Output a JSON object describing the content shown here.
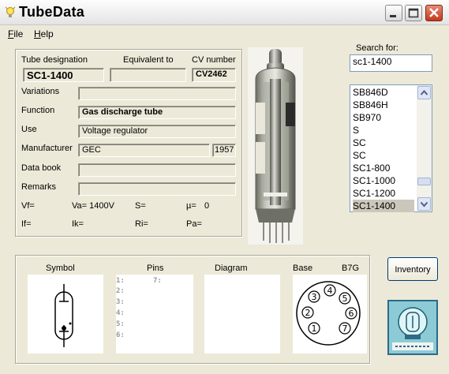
{
  "window": {
    "title": "TubeData"
  },
  "menu": {
    "file": "File",
    "help": "Help"
  },
  "headers": {
    "designation": "Tube designation",
    "equivalent": "Equivalent to",
    "cv": "CV number"
  },
  "tube": {
    "designation": "SC1-1400",
    "equivalent": "",
    "cv": "CV2462",
    "variations": "",
    "function": "Gas discharge tube",
    "use": "Voltage regulator",
    "manufacturer": "GEC",
    "year": "1957",
    "databook": "",
    "remarks": ""
  },
  "labels": {
    "variations": "Variations",
    "function": "Function",
    "use": "Use",
    "manufacturer": "Manufacturer",
    "databook": "Data book",
    "remarks": "Remarks"
  },
  "params": {
    "vf": "Vf=",
    "va": "Va= 1400V",
    "s": "S=",
    "mu": "µ=",
    "mu_val": "0",
    "if": "If=",
    "ik": "Ik=",
    "ri": "Ri=",
    "pa": "Pa="
  },
  "search": {
    "label": "Search for:",
    "value": "sc1-1400"
  },
  "list": [
    "SB846D",
    "SB846H",
    "SB970",
    "S",
    "SC",
    "SC",
    "SC1-800",
    "SC1-1000",
    "SC1-1200",
    "SC1-1400"
  ],
  "list_selected_index": 9,
  "bottom": {
    "symbol": "Symbol",
    "pins": "Pins",
    "diagram": "Diagram",
    "base": "Base",
    "base_type": "B7G"
  },
  "pins": {
    "p1": "1:",
    "p2": "2:",
    "p3": "3:",
    "p4": "4:",
    "p5": "5:",
    "p6": "6:",
    "p7": "7:"
  },
  "base_pins": [
    "1",
    "2",
    "3",
    "4",
    "5",
    "6",
    "7"
  ],
  "inventory": {
    "label": "Inventory"
  }
}
